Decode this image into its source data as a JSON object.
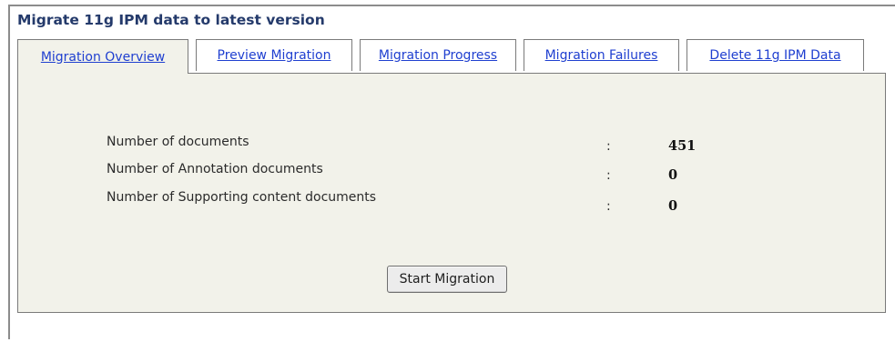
{
  "page": {
    "title": "Migrate 11g IPM data to latest version"
  },
  "tabs": [
    {
      "label": "Migration Overview",
      "active": true
    },
    {
      "label": "Preview Migration",
      "active": false
    },
    {
      "label": "Migration Progress",
      "active": false
    },
    {
      "label": "Migration Failures",
      "active": false
    },
    {
      "label": "Delete 11g IPM Data",
      "active": false
    }
  ],
  "overview": {
    "separator": ":",
    "rows": [
      {
        "label": "Number of documents",
        "value": "451"
      },
      {
        "label": "Number of Annotation documents",
        "value": "0"
      },
      {
        "label": "Number of Supporting content documents",
        "value": "0"
      }
    ],
    "start_button_label": "Start Migration"
  }
}
